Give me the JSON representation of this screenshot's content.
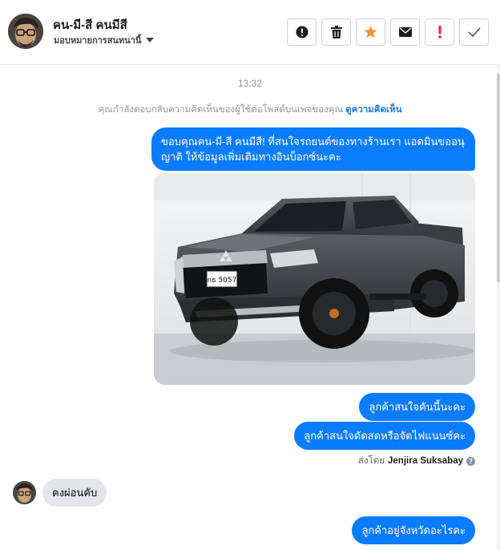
{
  "contact": {
    "name": "คน-มี-สี คนมีสี",
    "assign_label": "มอบหมายการสนทนานี้"
  },
  "actions": [
    {
      "name": "report-spam-button",
      "icon": "alert-circle-icon"
    },
    {
      "name": "delete-button",
      "icon": "trash-icon"
    },
    {
      "name": "star-button",
      "icon": "star-icon"
    },
    {
      "name": "mark-unread-button",
      "icon": "envelope-icon"
    },
    {
      "name": "follow-up-button",
      "icon": "exclamation-icon"
    },
    {
      "name": "mark-done-button",
      "icon": "checkmark-icon"
    }
  ],
  "thread": {
    "timestamp": "13:32",
    "notice_text": "คุณกำลังตอบกลับความคิดเห็นของผู้ใช้ต่อโพสต์บนเพจของคุณ",
    "notice_link": "ดูความคิดเห็น",
    "messages_out_1": "ขอบคุณคน-มี-สี คนมีสี! ที่สนใจรถยนต์ของทางร้านเรา แอดมินขออนุญาติ ให้ข้อมูลเพิ่มเติมทางอินบ็อกซ์นะคะ",
    "image": {
      "plate": "กธ 5057",
      "brand": "mitsubishi-emblem"
    },
    "message_out_2": "ลูกค้าสนใจคันนี้นะคะ",
    "message_out_3": "ลูกค้าสนใจดัดสดหรือจัดไฟแนนซ์คะ",
    "sent_by_label": "ส่งโดย",
    "sent_by_name": "Jenjira Suksabay",
    "info_glyph": "?",
    "message_in_1": "คงผ่อนคับ",
    "message_out_4": "ลูกค้าอยู่จังหวัดอะไรคะ"
  },
  "colors": {
    "outgoing": "#0a7cff",
    "incoming": "#e4e6eb",
    "star": "#f7923b",
    "follow_up": "#e41e3f",
    "link": "#1877f2"
  }
}
